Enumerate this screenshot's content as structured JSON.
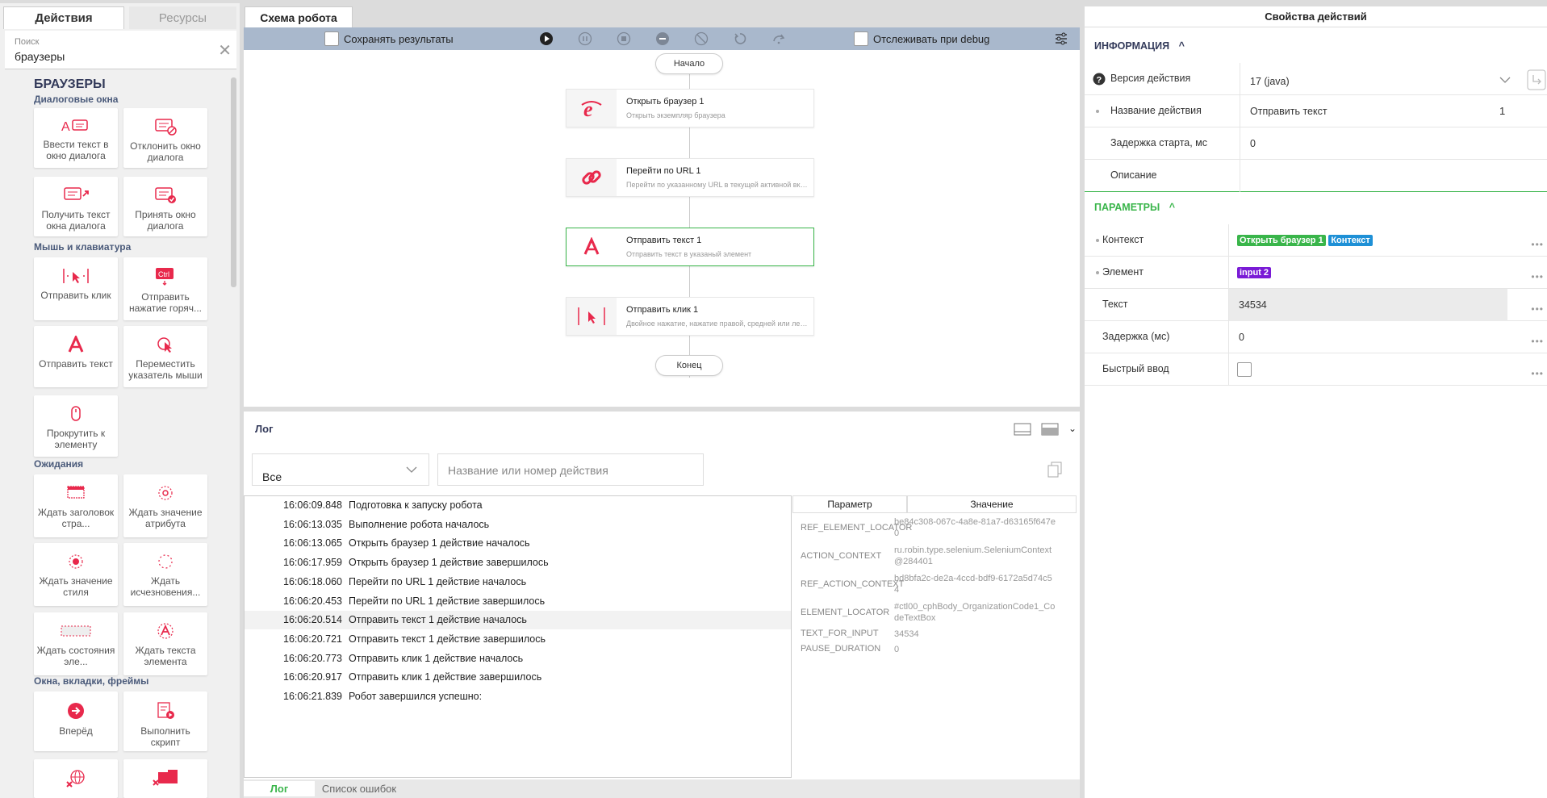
{
  "left": {
    "tabs": [
      "Действия",
      "Ресурсы"
    ],
    "search": {
      "label": "Поиск",
      "value": "браузеры"
    },
    "category": "БРАУЗЕРЫ",
    "groups": [
      "Диалоговые окна",
      "Мышь и клавиатура",
      "Ожидания",
      "Окна, вкладки, фреймы"
    ],
    "cards": [
      "Ввести текст в окно диалога",
      "Отклонить окно диалога",
      "Получить текст окна диалога",
      "Принять окно диалога",
      "Отправить клик",
      "Отправить нажатие горяч...",
      "Отправить текст",
      "Переместить указатель мыши",
      "Прокрутить к элементу",
      "Ждать заголовок стра...",
      "Ждать значение атрибута",
      "Ждать значение стиля",
      "Ждать исчезновения...",
      "Ждать состояния эле...",
      "Ждать текста элемента",
      "Вперёд",
      "Выполнить скрипт"
    ],
    "icons": [
      "text-dialog-icon",
      "dialog-reject-icon",
      "dialog-get-text-icon",
      "dialog-accept-icon",
      "click-icon",
      "hotkey-icon",
      "text-icon",
      "mouse-move-icon",
      "scroll-icon",
      "wait-title-icon",
      "wait-attr-icon",
      "wait-style-icon",
      "wait-disappear-icon",
      "wait-state-icon",
      "wait-text-icon",
      "forward-icon",
      "script-icon",
      "close-browser-icon",
      "close-tab-icon"
    ],
    "ctrl_label": "Ctrl"
  },
  "center": {
    "tab": "Схема робота",
    "toolbar": {
      "save_results": "Сохранять результаты",
      "track_debug": "Отслеживать при debug"
    },
    "start": "Начало",
    "end": "Конец",
    "nodes": [
      {
        "title": "Открыть браузер  1",
        "sub": "Открыть экземпляр браузера"
      },
      {
        "title": "Перейти по URL  1",
        "sub": "Перейти по указанному URL в текущей активной вкладке"
      },
      {
        "title": "Отправить текст  1",
        "sub": "Отправить текст в указаный элемент"
      },
      {
        "title": "Отправить клик  1",
        "sub": "Двойное нажатие, нажатие правой, средней или левой кнопкой"
      }
    ]
  },
  "log": {
    "title": "Лог",
    "filter": "Все",
    "search_placeholder": "Название или номер действия",
    "rows": [
      {
        "time": "16:06:09.848",
        "msg": "Подготовка к запуску робота"
      },
      {
        "time": "16:06:13.035",
        "msg": "Выполнение робота началось"
      },
      {
        "time": "16:06:13.065",
        "msg": "Открыть браузер 1 действие началось"
      },
      {
        "time": "16:06:17.959",
        "msg": "Открыть браузер 1 действие завершилось"
      },
      {
        "time": "16:06:18.060",
        "msg": "Перейти по URL 1 действие началось"
      },
      {
        "time": "16:06:20.453",
        "msg": "Перейти по URL 1 действие завершилось"
      },
      {
        "time": "16:06:20.514",
        "msg": "Отправить текст 1 действие началось"
      },
      {
        "time": "16:06:20.721",
        "msg": "Отправить текст 1 действие завершилось"
      },
      {
        "time": "16:06:20.773",
        "msg": "Отправить клик 1 действие началось"
      },
      {
        "time": "16:06:20.917",
        "msg": "Отправить клик 1 действие завершилось"
      },
      {
        "time": "16:06:21.839",
        "msg": "Робот завершился успешно:"
      }
    ],
    "param_headers": [
      "Параметр",
      "Значение"
    ],
    "params": [
      {
        "k": "REF_ELEMENT_LOCATOR",
        "v": "be84c308-067c-4a8e-81a7-d63165f647e0"
      },
      {
        "k": "ACTION_CONTEXT",
        "v": "ru.robin.type.selenium.SeleniumContext@284401"
      },
      {
        "k": "REF_ACTION_CONTEXT",
        "v": "bd8bfa2c-de2a-4ccd-bdf9-6172a5d74c54"
      },
      {
        "k": "ELEMENT_LOCATOR",
        "v": "#ctl00_cphBody_OrganizationCode1_CodeTextBox"
      },
      {
        "k": "TEXT_FOR_INPUT",
        "v": "34534"
      },
      {
        "k": "PAUSE_DURATION",
        "v": "0"
      }
    ],
    "tabs": [
      "Лог",
      "Список ошибок"
    ]
  },
  "right": {
    "title": "Свойства действий",
    "info_title": "ИНФОРМАЦИЯ",
    "params_title": "ПАРАМЕТРЫ",
    "version_label": "Версия действия",
    "version_value": "17 (java)",
    "name_label": "Название действия",
    "name_value": "Отправить текст",
    "name_index": "1",
    "delay_label": "Задержка старта, мс",
    "delay_value": "0",
    "desc_label": "Описание",
    "context_label": "Контекст",
    "context_tag1": "Открыть браузер 1",
    "context_tag2": "Контекст",
    "element_label": "Элемент",
    "element_tag": "input 2",
    "text_label": "Текст",
    "text_value": "34534",
    "pause_label": "Задержка (мс)",
    "pause_value": "0",
    "fast_label": "Быстрый ввод"
  },
  "colors": {
    "accent": "#e8294c",
    "green": "#39b54a",
    "blue": "#1e90d6",
    "purple": "#7a1bd6",
    "toolbar": "#a9b8cc"
  }
}
